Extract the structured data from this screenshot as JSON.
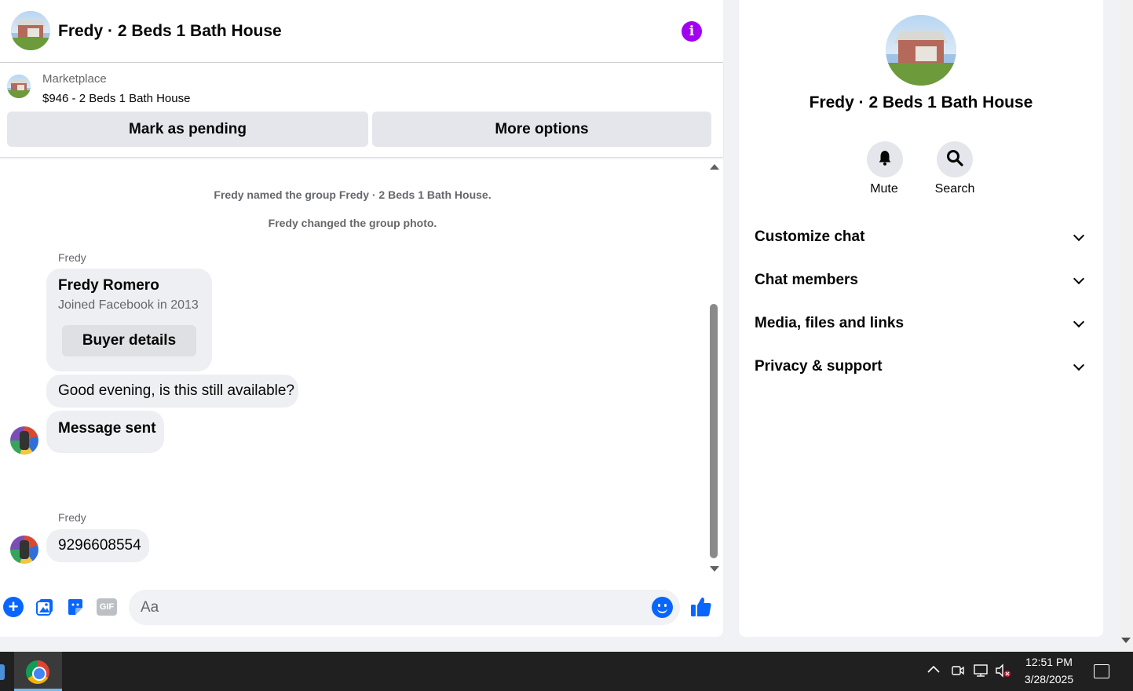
{
  "chat": {
    "title": "Fredy · 2 Beds 1 Bath House",
    "listing": {
      "source": "Marketplace",
      "title": "$946 - 2 Beds 1 Bath House",
      "mark_pending": "Mark as pending",
      "more_options": "More options"
    },
    "system_messages": [
      "Fredy named the group Fredy · 2 Beds 1 Bath House.",
      "Fredy changed the group photo."
    ],
    "messages": {
      "sender_1": "Fredy",
      "card_name": "Fredy Romero",
      "card_sub": "Joined Facebook in 2013",
      "card_button": "Buyer details",
      "msg_1": "Good evening, is this still available?",
      "msg_2": "Message sent",
      "sender_2": "Fredy",
      "msg_3": "9296608554"
    },
    "composer": {
      "placeholder": "Aa",
      "gif_label": "GIF"
    }
  },
  "info_panel": {
    "title": "Fredy · 2 Beds 1 Bath House",
    "mute_label": "Mute",
    "search_label": "Search",
    "sections": [
      "Customize chat",
      "Chat members",
      "Media, files and links",
      "Privacy & support"
    ]
  },
  "taskbar": {
    "time": "12:51 PM",
    "date": "3/28/2025"
  },
  "colors": {
    "accent": "#0866ff",
    "info_accent": "#a200f0",
    "bubble": "#eeeff2"
  }
}
